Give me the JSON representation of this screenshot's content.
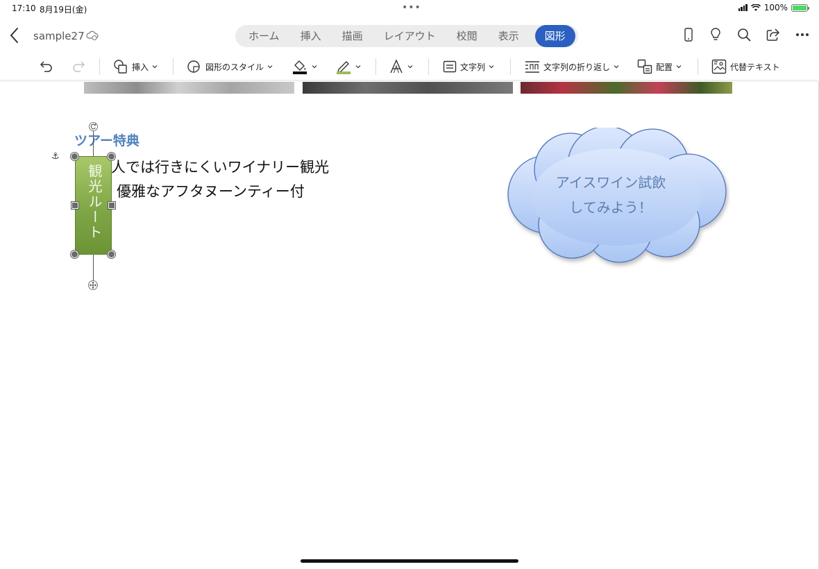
{
  "status": {
    "time": "17:10",
    "date": "8月19日(金)",
    "battery": "100%"
  },
  "title": {
    "doc_name": "sample27"
  },
  "tabs": [
    {
      "label": "ホーム"
    },
    {
      "label": "挿入"
    },
    {
      "label": "描画"
    },
    {
      "label": "レイアウト"
    },
    {
      "label": "校閲"
    },
    {
      "label": "表示"
    },
    {
      "label": "図形",
      "active": true
    }
  ],
  "toolbar": {
    "insert_label": "挿入",
    "shape_style_label": "図形のスタイル",
    "text_direction_label": "文字列",
    "wrap_label": "文字列の折り返し",
    "arrange_label": "配置",
    "alt_text_label": "代替テキスト"
  },
  "document": {
    "heading": "ツアー特典",
    "line1": "人では行きにくいワイナリー観光",
    "line2": "優雅なアフタヌーンティー付",
    "shape_text": "観光ルート",
    "cloud_line1": "アイスワイン試飲",
    "cloud_line2": "してみよう！"
  },
  "colors": {
    "accent": "#2b5fc1",
    "heading": "#4f81bd",
    "shape_green": "#7fa646",
    "cloud_fill": "#c7d9fb"
  }
}
